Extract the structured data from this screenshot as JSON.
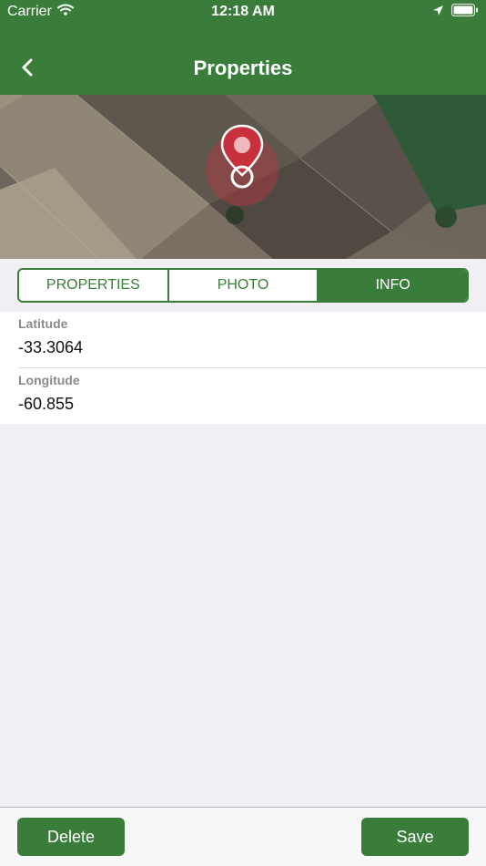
{
  "status_bar": {
    "carrier": "Carrier",
    "time": "12:18 AM"
  },
  "nav": {
    "title": "Properties",
    "back_icon": "chevron-left-icon"
  },
  "map": {
    "marker_icon": "map-pin-icon"
  },
  "tabs": [
    {
      "label": "PROPERTIES",
      "active": false
    },
    {
      "label": "PHOTO",
      "active": false
    },
    {
      "label": "INFO",
      "active": true
    }
  ],
  "info": {
    "latitude": {
      "label": "Latitude",
      "value": "-33.3064"
    },
    "longitude": {
      "label": "Longitude",
      "value": "-60.855"
    }
  },
  "actions": {
    "delete_label": "Delete",
    "save_label": "Save"
  },
  "colors": {
    "brand_green": "#3a7d3a",
    "marker_red": "#c8303c",
    "background": "#efeff4"
  }
}
